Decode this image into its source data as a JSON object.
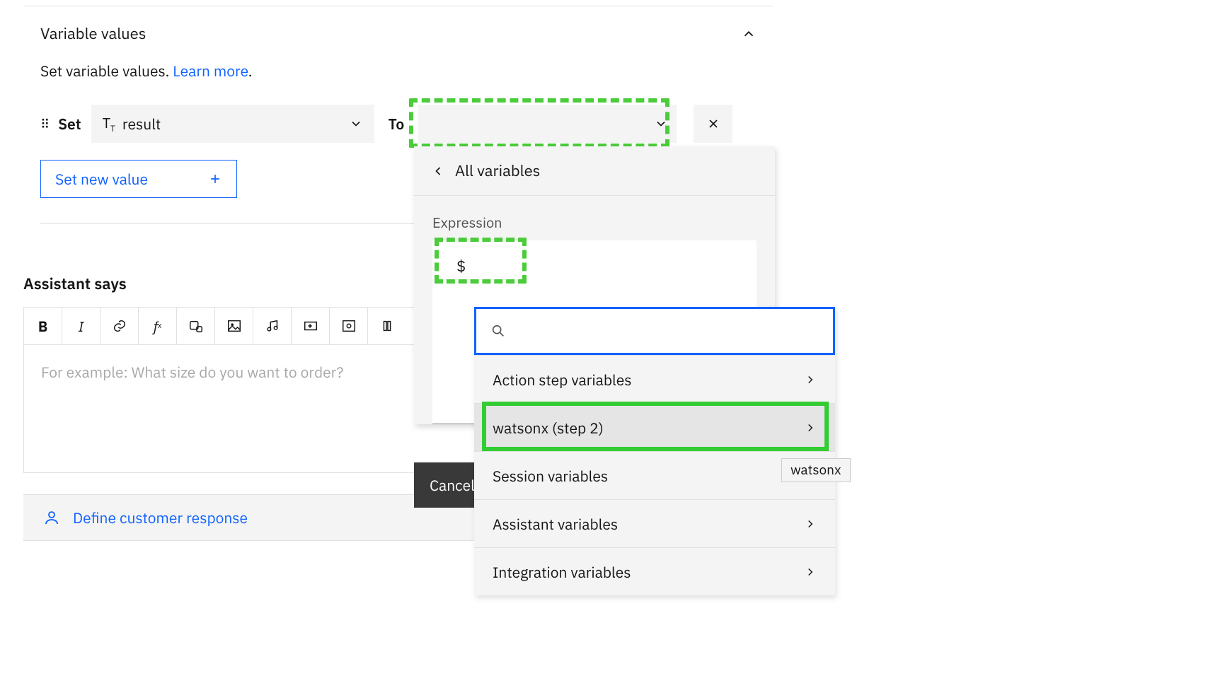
{
  "section": {
    "title": "Variable values",
    "subtitle_text": "Set variable values. ",
    "learn_more": "Learn more",
    "period": "."
  },
  "setrow": {
    "set_label": "Set",
    "variable_name": "result",
    "to_label": "To"
  },
  "buttons": {
    "set_new_value": "Set new value",
    "cancel": "Cancel"
  },
  "assistant": {
    "heading": "Assistant says",
    "placeholder": "For example: What size do you want to order?"
  },
  "define_response": "Define customer response",
  "popover": {
    "back_label": "All variables",
    "expression_label": "Expression",
    "expression_value": "$"
  },
  "varlist": {
    "items": [
      "Action step variables",
      "watsonx (step 2)",
      "Session variables",
      "Assistant variables",
      "Integration variables"
    ]
  },
  "tooltip": "watsonx"
}
